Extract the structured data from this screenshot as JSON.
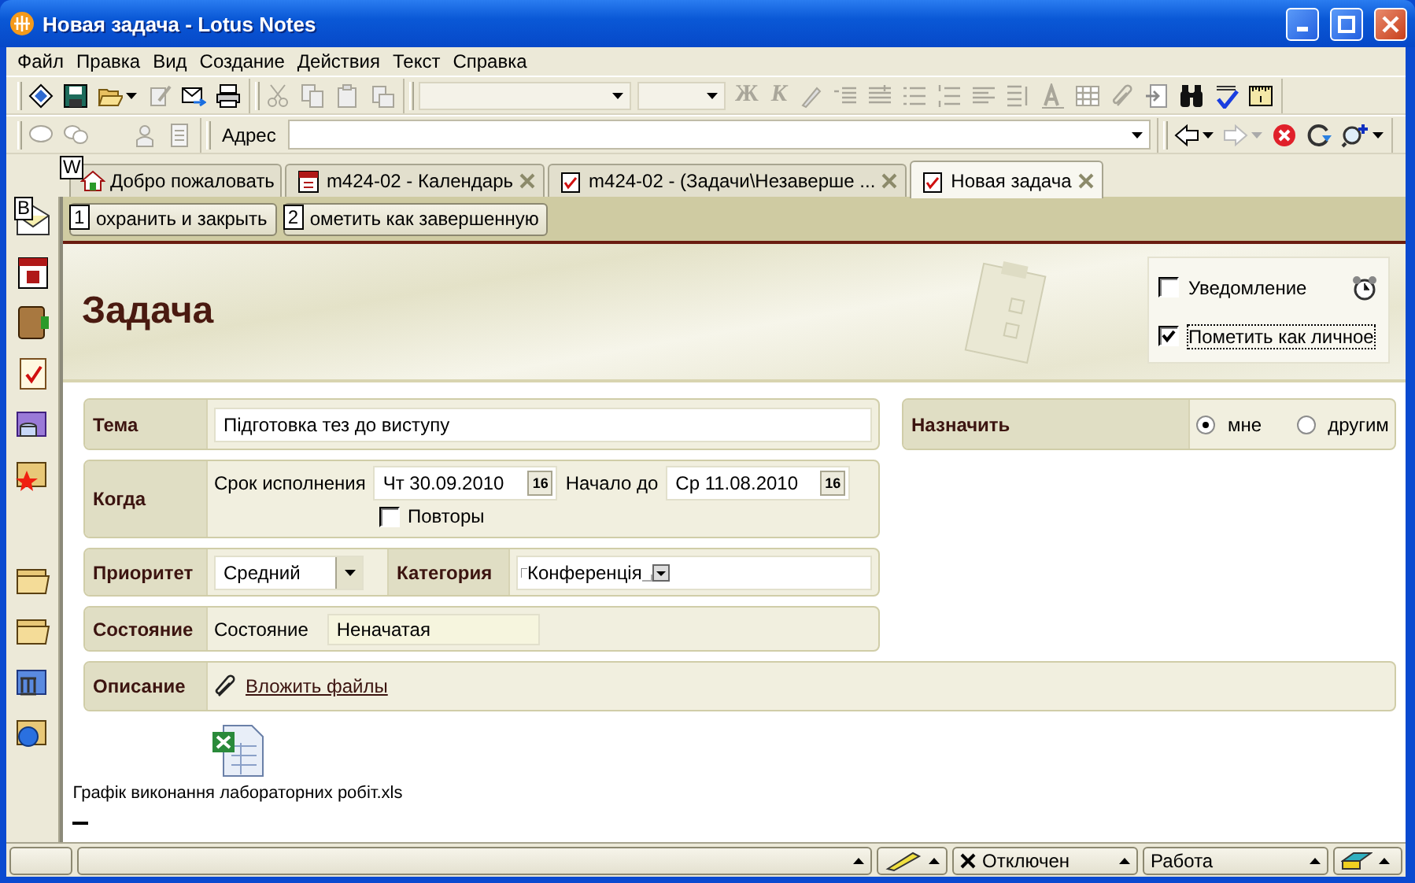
{
  "window": {
    "title": "Новая задача - Lotus Notes"
  },
  "menu": [
    "Файл",
    "Правка",
    "Вид",
    "Создание",
    "Действия",
    "Текст",
    "Справка"
  ],
  "format_buttons": [
    "Ж",
    "К"
  ],
  "address": {
    "label": "Адрес"
  },
  "tab_hint": "W",
  "tabs": [
    {
      "label": "Добро пожаловать",
      "selected": false,
      "closable": false
    },
    {
      "label": "m424-02 - Календарь",
      "selected": false,
      "closable": true
    },
    {
      "label": "m424-02 - (Задачи\\Незаверше ...",
      "selected": false,
      "closable": true
    },
    {
      "label": "Новая задача",
      "selected": true,
      "closable": true
    }
  ],
  "sidebar_hint": "B",
  "actions": [
    {
      "hint": "1",
      "label": "охранить и закрыть"
    },
    {
      "hint": "2",
      "label": "ометить как завершенную"
    }
  ],
  "form": {
    "title": "Задача",
    "notify": {
      "label": "Уведомление",
      "checked": false
    },
    "private": {
      "label": "Пометить как личное",
      "checked": true
    },
    "subject": {
      "label": "Тема",
      "value": "Підготовка тез до виступу"
    },
    "assign": {
      "label": "Назначить",
      "options": [
        {
          "label": "мне",
          "selected": true
        },
        {
          "label": "другим",
          "selected": false
        }
      ]
    },
    "when": {
      "label": "Когда",
      "due_label": "Срок исполнения",
      "due": "Чт 30.09.2010",
      "due_picker": "16",
      "start_label": "Начало до",
      "start": "Ср 11.08.2010",
      "start_picker": "16",
      "repeat": {
        "label": "Повторы",
        "checked": false
      }
    },
    "priority": {
      "label": "Приоритет",
      "value": "Средний"
    },
    "category": {
      "label": "Категория",
      "value": "Конференція"
    },
    "status": {
      "label": "Состояние",
      "field_label": "Состояние",
      "value": "Неначатая"
    },
    "description": {
      "label": "Описание",
      "link": "Вложить файлы"
    },
    "attachment": {
      "name": "Графік виконання лабораторних робіт.xls"
    }
  },
  "status_bar": {
    "connection": "Отключен",
    "location": "Работа"
  }
}
